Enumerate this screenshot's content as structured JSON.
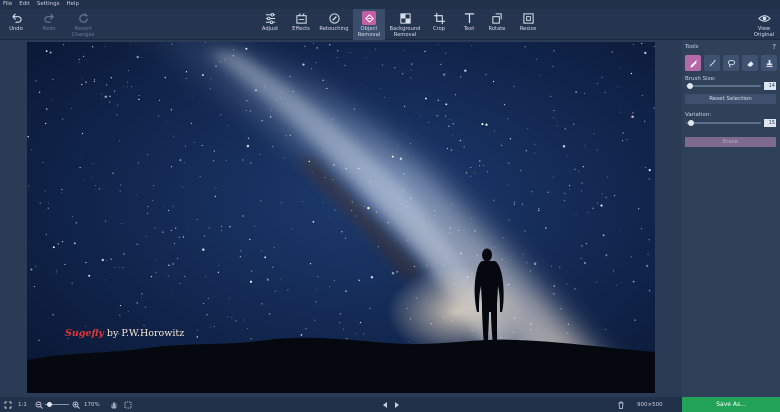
{
  "menu": [
    "File",
    "Edit",
    "Settings",
    "Help"
  ],
  "toolbar": {
    "undo": "Undo",
    "redo": "Redo",
    "revert": [
      "Revert",
      "Changes"
    ],
    "adjust": "Adjust",
    "effects": "Effects",
    "retouching": "Retouching",
    "object_removal": [
      "Object",
      "Removal"
    ],
    "background_removal": [
      "Background",
      "Removal"
    ],
    "crop": "Crop",
    "text": "Text",
    "rotate": "Rotate",
    "resize": "Resize",
    "view_original": [
      "View",
      "Original"
    ]
  },
  "panel": {
    "tools_label": "Tools",
    "help": "?",
    "brush_size_label": "Brush Size:",
    "brush_size_value": "14",
    "brush_size_level": 0.05,
    "reset_selection": "Reset Selection",
    "variation_label": "Variation:",
    "variation_value": "15",
    "variation_level": 0.07,
    "erase_button": "Erase"
  },
  "watermark": {
    "brand": "Sugefly",
    "author": "by P.W.Horowitz"
  },
  "statusbar": {
    "zoom_one": "1:1",
    "zoom_level": "170%",
    "dimensions": "900×500",
    "save": "Save As..."
  },
  "colors": {
    "accent": "#c45fa5",
    "save": "#23a25a"
  }
}
